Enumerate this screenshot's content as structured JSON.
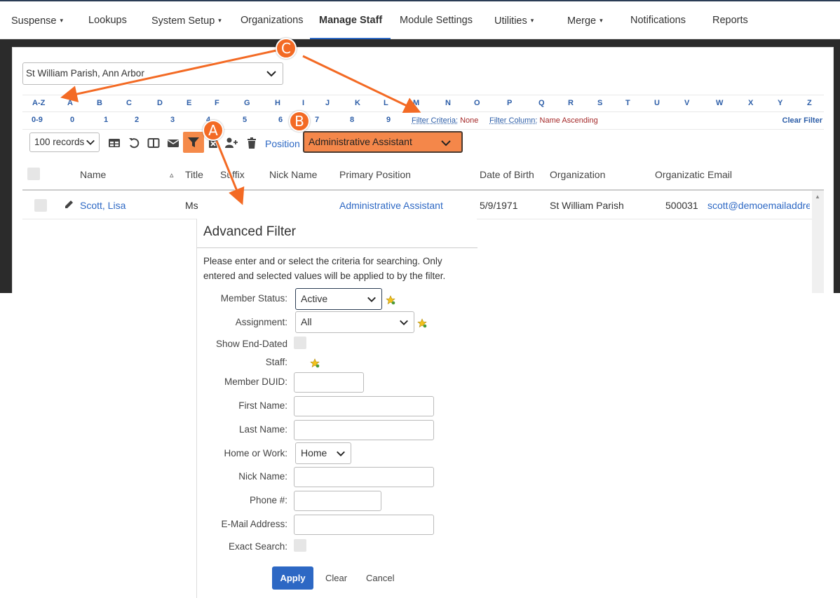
{
  "nav": {
    "items": [
      {
        "label": "Suspense",
        "dropdown": true
      },
      {
        "label": "Lookups",
        "dropdown": false
      },
      {
        "label": "System Setup",
        "dropdown": true
      },
      {
        "label": "Organizations",
        "dropdown": false
      },
      {
        "label": "Manage Staff",
        "dropdown": false,
        "active": true
      },
      {
        "label": "Module Settings",
        "dropdown": false
      },
      {
        "label": "Utilities",
        "dropdown": true
      },
      {
        "label": "Merge",
        "dropdown": true
      },
      {
        "label": "Notifications",
        "dropdown": false
      },
      {
        "label": "Reports",
        "dropdown": false
      }
    ],
    "caret": "▾"
  },
  "org_select": {
    "value": "St William Parish, Ann Arbor"
  },
  "alphabet": {
    "row1": [
      "A-Z",
      "A",
      "B",
      "C",
      "D",
      "E",
      "F",
      "G",
      "H",
      "I",
      "J",
      "K",
      "L",
      "M",
      "N",
      "O",
      "P",
      "Q",
      "R",
      "S",
      "T",
      "U",
      "V",
      "W",
      "X",
      "Y",
      "Z"
    ],
    "row2": [
      "0-9",
      "0",
      "1",
      "2",
      "3",
      "4",
      "5",
      "6",
      "7",
      "8",
      "9"
    ],
    "filter_criteria": {
      "key": "Filter Criteria:",
      "value": "None"
    },
    "filter_column": {
      "key": "Filter Column:",
      "value": "Name Ascending"
    },
    "clear_filter": "Clear Filter"
  },
  "toolbar": {
    "records": "100 records",
    "position_label": "Position",
    "position_value": "Administrative Assistant"
  },
  "table": {
    "headers": {
      "name": "Name",
      "sort": "▵",
      "title": "Title",
      "suffix": "Suffix",
      "nick": "Nick Name",
      "position": "Primary Position",
      "dob": "Date of Birth",
      "org": "Organization",
      "org_id": "Organizatic",
      "email": "Email"
    },
    "row": {
      "name": "Scott, Lisa",
      "title": "Ms",
      "position": "Administrative Assistant",
      "dob": "5/9/1971",
      "org": "St William Parish",
      "org_id": "500031",
      "email": "scott@demoemailaddre"
    }
  },
  "dialog": {
    "title": "Advanced Filter",
    "description": "Please enter and or select the criteria for searching. Only entered and selected values will be applied to by the filter.",
    "member_status": {
      "label": "Member Status:",
      "value": "Active"
    },
    "assignment": {
      "label": "Assignment:",
      "value": "All"
    },
    "show_end_dated": {
      "label1": "Show End-Dated",
      "label2": "Staff:"
    },
    "member_duid": {
      "label": "Member DUID:"
    },
    "first_name": {
      "label": "First Name:"
    },
    "last_name": {
      "label": "Last Name:"
    },
    "home_or_work": {
      "label": "Home or Work:",
      "value": "Home"
    },
    "nick_name": {
      "label": "Nick Name:"
    },
    "phone": {
      "label": "Phone #:"
    },
    "email": {
      "label": "E-Mail Address:"
    },
    "exact_search": {
      "label": "Exact Search:"
    },
    "apply": "Apply",
    "clear": "Clear",
    "cancel": "Cancel"
  },
  "callouts": {
    "a": "A",
    "b": "B",
    "c": "C"
  },
  "colors": {
    "accent": "#2d68c4",
    "callout": "#f36a24",
    "highlight": "#f4874a",
    "filter_value": "#a52a2a"
  }
}
